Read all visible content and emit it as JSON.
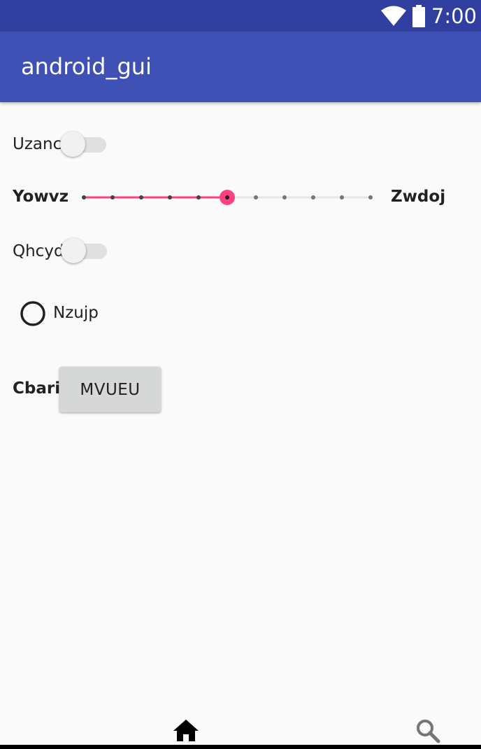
{
  "status_bar": {
    "time": "7:00",
    "icons": [
      "wifi-icon",
      "battery-icon"
    ]
  },
  "app_bar": {
    "title": "android_gui"
  },
  "colors": {
    "status_bar": "#303f9f",
    "app_bar": "#3f51b5",
    "accent": "#ff4081",
    "background": "#fafafa"
  },
  "form": {
    "switch1": {
      "label": "Uzanc",
      "checked": false
    },
    "slider": {
      "left_label": "Yowvz",
      "right_label": "Zwdoj",
      "min": 0,
      "max": 10,
      "value": 5
    },
    "switch2": {
      "label": "Qhcyd",
      "checked": false
    },
    "radio": {
      "label": "Nzujp",
      "checked": false
    },
    "button_row": {
      "label": "Cbari",
      "button_label": "MVUEU"
    }
  },
  "bottom_nav": {
    "items": [
      {
        "icon": "home-icon"
      },
      {
        "icon": "search-icon"
      }
    ]
  }
}
